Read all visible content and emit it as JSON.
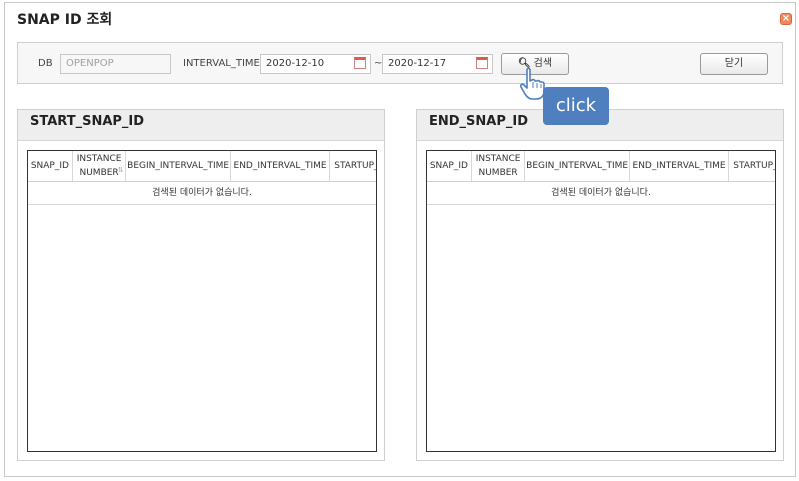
{
  "dialog": {
    "title": "SNAP ID 조회",
    "close_icon": "close-icon"
  },
  "search": {
    "db_label": "DB",
    "db_value": "OPENPOP",
    "interval_label": "INTERVAL_TIME",
    "date_from": "2020-12-10",
    "date_to": "2020-12-17",
    "range_separator": "~",
    "search_label": "검색",
    "close_label": "닫기"
  },
  "start_panel": {
    "title": "START_SNAP_ID",
    "columns": [
      "SNAP_ID",
      "INSTANCE",
      "NUMBER",
      "BEGIN_INTERVAL_TIME",
      "END_INTERVAL_TIME",
      "STARTUP_"
    ],
    "empty_message": "검색된 데이터가 없습니다."
  },
  "end_panel": {
    "title": "END_SNAP_ID",
    "columns": [
      "SNAP_ID",
      "INSTANCE",
      "NUMBER",
      "BEGIN_INTERVAL_TIME",
      "END_INTERVAL_TIME",
      "STARTUP_"
    ],
    "empty_message": "검색된 데이터가 없습니다."
  },
  "overlay": {
    "tooltip": "click"
  },
  "colors": {
    "tooltip_bg": "#4f7fbf",
    "close_btn": "#f08a5d",
    "panel_head": "#eeeeee"
  }
}
